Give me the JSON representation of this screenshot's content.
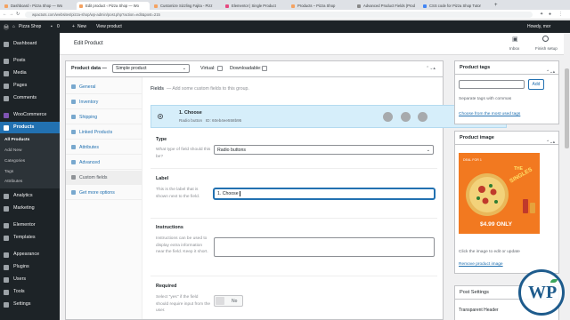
{
  "browser": {
    "tabs": [
      {
        "label": "Dashboard ‹ Pizza Shop — Wo",
        "color": "#f4a261"
      },
      {
        "label": "Edit product ‹ Pizza Shop — Wo",
        "color": "#f4a261"
      },
      {
        "label": "Customize Sizzling Fajita - Pizz",
        "color": "#f4a261"
      },
      {
        "label": "Elementor | Single Product",
        "color": "#f4a261"
      },
      {
        "label": "Products – Pizza Shop",
        "color": "#f4a261"
      },
      {
        "label": "Advanced Product Fields (Prod",
        "color": "#888888"
      },
      {
        "label": "CSS code for Pizza Shop Tutor",
        "color": "#4285f4"
      }
    ],
    "url": "wpactuts.com/websites/pizza-shop/wp-admin/post.php?action=edit&post=215"
  },
  "adminbar": {
    "site": "Pizza Shop",
    "comments": "0",
    "new": "New",
    "view": "View product",
    "howdy": "Howdy, mor"
  },
  "sidebar": {
    "items": [
      "Dashboard",
      "Posts",
      "Media",
      "Pages",
      "Comments",
      "WooCommerce",
      "Products",
      "Analytics",
      "Marketing",
      "Elementor",
      "Templates",
      "Appearance",
      "Plugins",
      "Users",
      "Tools",
      "Settings"
    ],
    "sub": [
      "All Products",
      "Add New",
      "Categories",
      "Tags",
      "Attributes"
    ]
  },
  "header": {
    "title": "Edit Product",
    "inbox": "Inbox",
    "finish": "Finish setup"
  },
  "product": {
    "data_label": "Product data —",
    "type": "Simple product",
    "virtual": "Virtual:",
    "downloadable": "Downloadable:",
    "tabs": [
      "General",
      "Inventory",
      "Shipping",
      "Linked Products",
      "Attributes",
      "Advanced",
      "Custom fields",
      "Get more options"
    ],
    "fields_title": "Fields",
    "fields_hint": "— Add some custom fields to this group.",
    "field_name": "1. Choose",
    "field_meta": "Radio button   ID: 60eb4ee558b95"
  },
  "editor": {
    "type_label": "Type",
    "type_desc": "What type of field should this be?",
    "type_value": "Radio buttons",
    "label_label": "Label",
    "label_desc": "This is the label that is shown next to the field.",
    "label_value": "1. Choose",
    "instr_label": "Instructions",
    "instr_desc": "Instructions can be used to display extra information near the field. Keep it short.",
    "req_label": "Required",
    "req_desc": "Select \"yes\" if the field should require input from the user.",
    "req_value": "No"
  },
  "right": {
    "tags_title": "Product tags",
    "add_btn": "Add",
    "sep": "Separate tags with commas",
    "choose": "Choose from the most used tags",
    "image_title": "Product image",
    "image_deal": "DEAL FOR 1",
    "image_text1": "THE",
    "image_text2": "SINGLES",
    "image_price": "$4.99 ONLY",
    "click_hint": "Click the image to edit or update",
    "remove": "Remove product image",
    "post_settings": "Post Settings",
    "transparent": "Transparent Header"
  },
  "watermark": "WP"
}
